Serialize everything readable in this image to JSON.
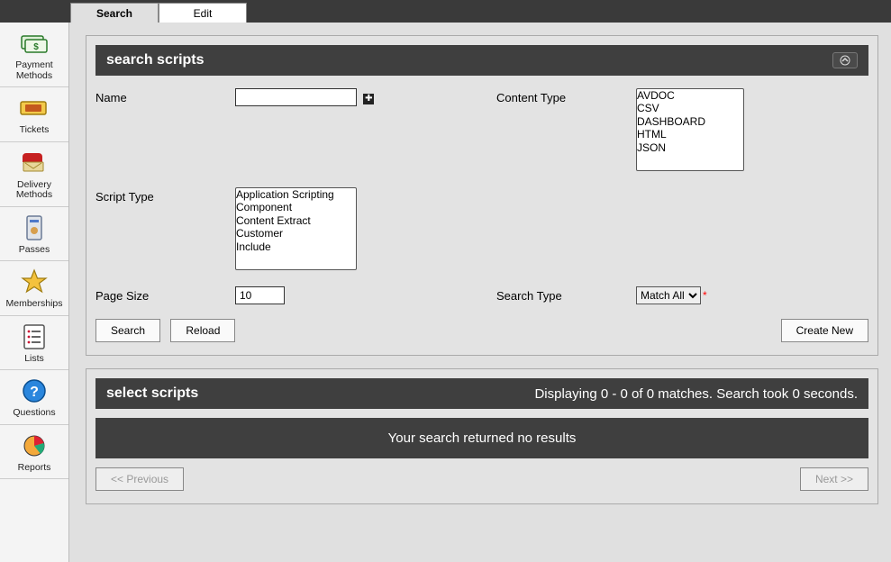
{
  "tabs": {
    "search": "Search",
    "edit": "Edit"
  },
  "sidebar": {
    "items": [
      {
        "label": "Payment Methods"
      },
      {
        "label": "Tickets"
      },
      {
        "label": "Delivery Methods"
      },
      {
        "label": "Passes"
      },
      {
        "label": "Memberships"
      },
      {
        "label": "Lists"
      },
      {
        "label": "Questions"
      },
      {
        "label": "Reports"
      }
    ]
  },
  "search_panel": {
    "title": "search scripts",
    "labels": {
      "name": "Name",
      "content_type": "Content Type",
      "script_type": "Script Type",
      "page_size": "Page Size",
      "search_type": "Search Type"
    },
    "name_value": "",
    "page_size_value": "10",
    "content_type_options": [
      "AVDOC",
      "CSV",
      "DASHBOARD",
      "HTML",
      "JSON"
    ],
    "script_type_options": [
      "Application Scripting",
      "Component",
      "Content Extract",
      "Customer",
      "Include"
    ],
    "search_type_selected": "Match All",
    "search_type_options": [
      "Match All"
    ],
    "buttons": {
      "search": "Search",
      "reload": "Reload",
      "create": "Create New"
    }
  },
  "results": {
    "title": "select scripts",
    "summary": "Displaying 0 - 0 of 0 matches. Search took 0 seconds.",
    "empty": "Your search returned no results",
    "prev": "<< Previous",
    "next": "Next >>"
  }
}
